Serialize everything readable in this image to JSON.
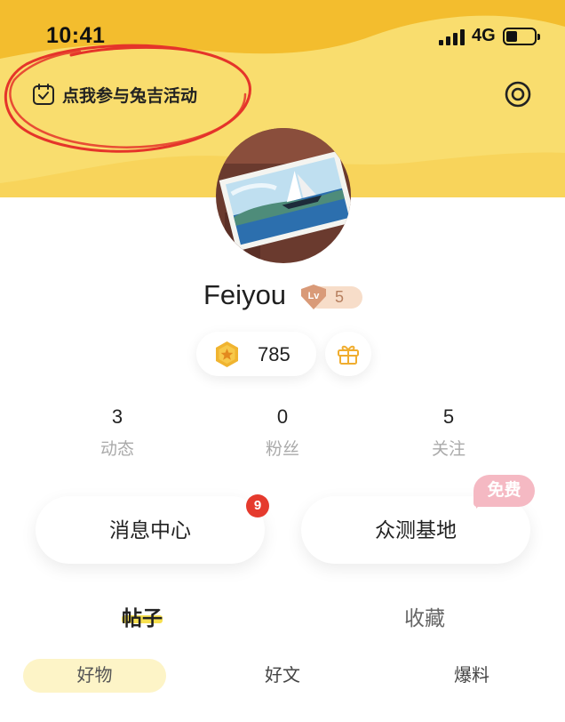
{
  "status_bar": {
    "time": "10:41",
    "network": "4G"
  },
  "header": {
    "promo_text": "点我参与兔吉活动",
    "colors": {
      "bg": "#f9dd6e",
      "wave": "#f3bd2e"
    }
  },
  "profile": {
    "username": "Feiyou",
    "level_label": "Lv",
    "level": "5",
    "coins": "785"
  },
  "stats": [
    {
      "value": "3",
      "label": "动态"
    },
    {
      "value": "0",
      "label": "粉丝"
    },
    {
      "value": "5",
      "label": "关注"
    }
  ],
  "cards": {
    "messages": {
      "label": "消息中心",
      "badge": "9"
    },
    "testing": {
      "label": "众测基地",
      "tag": "免费"
    }
  },
  "tabs": [
    {
      "label": "帖子",
      "active": true
    },
    {
      "label": "收藏",
      "active": false
    }
  ],
  "subtabs": [
    {
      "label": "好物",
      "active": true
    },
    {
      "label": "好文",
      "active": false
    },
    {
      "label": "爆料",
      "active": false
    }
  ],
  "icons": {
    "promo": "calendar-check-icon",
    "settings": "settings-icon",
    "coin": "star-coin-icon",
    "gift": "gift-icon",
    "level": "level-badge-icon"
  }
}
